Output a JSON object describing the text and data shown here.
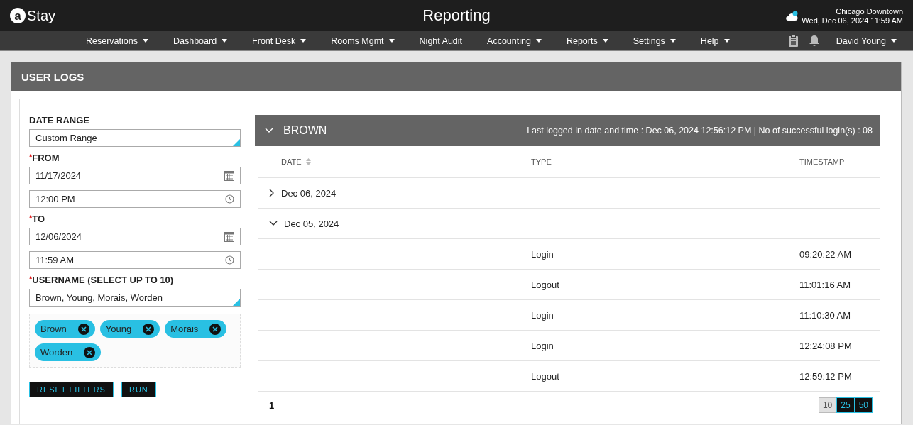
{
  "app": {
    "logo_mark": "a",
    "logo_text": "Stay",
    "title": "Reporting",
    "location": "Chicago Downtown",
    "datetime": "Wed, Dec 06, 2024 11:59 AM"
  },
  "nav": {
    "items": [
      {
        "label": "Reservations",
        "dropdown": true
      },
      {
        "label": "Dashboard",
        "dropdown": true
      },
      {
        "label": "Front Desk",
        "dropdown": true
      },
      {
        "label": "Rooms Mgmt",
        "dropdown": true
      },
      {
        "label": "Night Audit",
        "dropdown": false
      },
      {
        "label": "Accounting",
        "dropdown": true
      },
      {
        "label": "Reports",
        "dropdown": true
      },
      {
        "label": "Settings",
        "dropdown": true
      },
      {
        "label": "Help",
        "dropdown": true
      }
    ],
    "user": "David Young"
  },
  "page_title": "USER LOGS",
  "filters": {
    "date_range": {
      "label": "DATE RANGE",
      "value": "Custom Range"
    },
    "from": {
      "label": "FROM",
      "required_mark": "*",
      "date": "11/17/2024",
      "time": "12:00 PM"
    },
    "to": {
      "label": "TO",
      "required_mark": "*",
      "date": "12/06/2024",
      "time": "11:59 AM"
    },
    "username": {
      "label": "USERNAME (SELECT UP TO 10)",
      "required_mark": "*",
      "value": "Brown, Young, Morais, Worden"
    },
    "chips": [
      "Brown",
      "Young",
      "Morais",
      "Worden"
    ],
    "buttons": [
      "RESET FILTERS",
      "RUN"
    ]
  },
  "user_group": {
    "name": "BROWN",
    "expanded": true,
    "summary": "Last logged in date and time : Dec 06, 2024 12:56:12 PM | No of successful login(s) : 08",
    "columns": [
      {
        "label": "DATE",
        "sortable": true
      },
      {
        "label": "TYPE",
        "sortable": false
      },
      {
        "label": "TIMESTAMP",
        "sortable": false
      }
    ],
    "rows": [
      {
        "date": "Dec 06, 2024",
        "expanded": false
      },
      {
        "date": "Dec 05, 2024",
        "expanded": true,
        "entries": [
          {
            "type": "Login",
            "timestamp": "09:20:22 AM"
          },
          {
            "type": "Logout",
            "timestamp": "11:01:16 AM"
          },
          {
            "type": "Login",
            "timestamp": "11:10:30 AM"
          },
          {
            "type": "Login",
            "timestamp": "12:24:08 PM"
          },
          {
            "type": "Logout",
            "timestamp": "12:59:12 PM"
          }
        ]
      }
    ]
  },
  "pagination": {
    "pages": [
      {
        "label": "1",
        "selected": true
      }
    ],
    "page_sizes": [
      {
        "label": "10",
        "selected": true
      },
      {
        "label": "25",
        "selected": false
      },
      {
        "label": "50",
        "selected": false
      }
    ]
  }
}
